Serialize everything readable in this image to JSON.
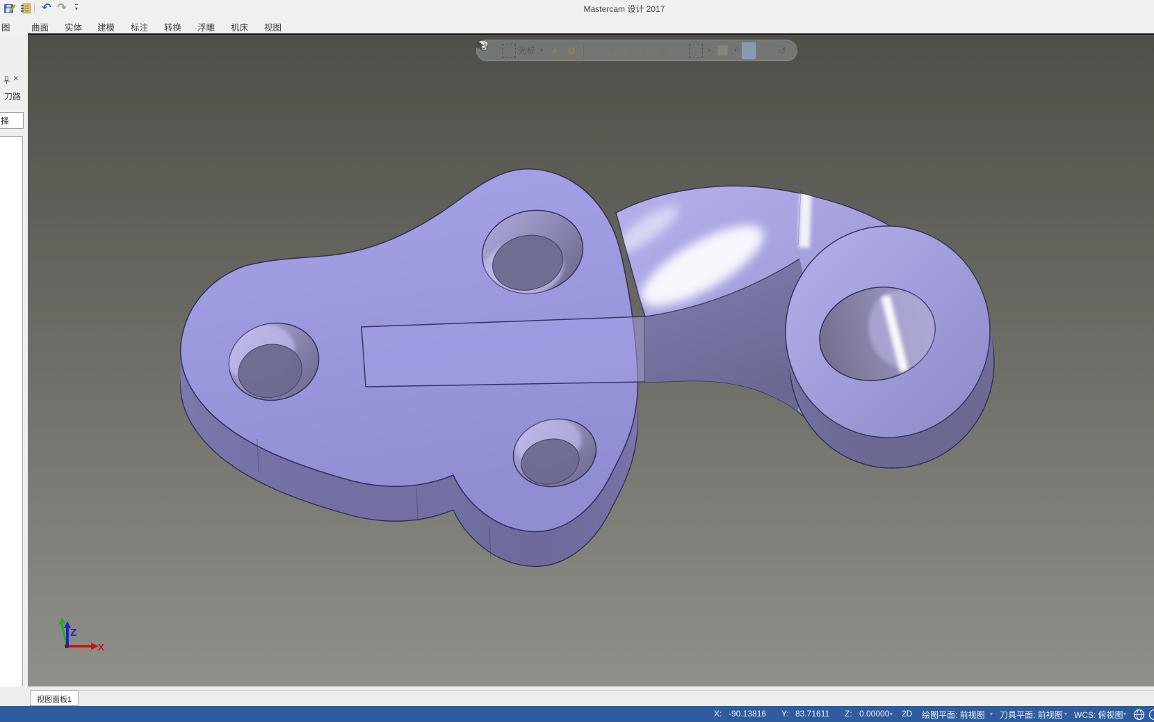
{
  "window": {
    "title": "Mastercam 设计 2017"
  },
  "quick_access": {
    "undo_glyph": "↶",
    "redo_glyph": "↷",
    "more_glyph": "▾"
  },
  "ribbon_tabs": [
    {
      "label": "图"
    },
    {
      "label": "曲面"
    },
    {
      "label": "实体"
    },
    {
      "label": "建模"
    },
    {
      "label": "标注"
    },
    {
      "label": "转换"
    },
    {
      "label": "浮雕"
    },
    {
      "label": "机床"
    },
    {
      "label": "视图"
    }
  ],
  "left_panel": {
    "title": "刀路",
    "close_glyph": "×",
    "filter_value": "择"
  },
  "viewport_toolbar": {
    "cursor_label": "光标",
    "caret": "▾",
    "gear_glyph": "⚙",
    "spark_glyph": "⚡",
    "rotate_ccw_glyph": "↺",
    "rotate_cw_glyph": "↻",
    "orbit_glyph": "⊙",
    "pan_glyph": "⊕",
    "grid_glyph": "▦",
    "check_glyph": "✓"
  },
  "gnomon": {
    "x_label": "X",
    "z_label": "Z"
  },
  "bottom_tabs": [
    {
      "label": "视图面板1"
    }
  ],
  "status_bar": {
    "x_label": "X:",
    "x_value": "-90.13816",
    "y_label": "Y:",
    "y_value": "83.71611",
    "z_label": "Z:",
    "z_value": "0.00000",
    "mode": "2D",
    "cplane": "绘图平面: 前视图",
    "tplane": "刀具平面: 前视图",
    "wcs": "WCS: 俯视图",
    "caret": "▾"
  },
  "colors": {
    "status_bar_bg": "#2e5c9e",
    "model_face": "#9e9be2",
    "model_side": "#7e7bb0",
    "axis_x": "#cc1111",
    "axis_z": "#2222cc",
    "axis_y": "#22aa22",
    "accent_gold": "#b08d2e"
  }
}
